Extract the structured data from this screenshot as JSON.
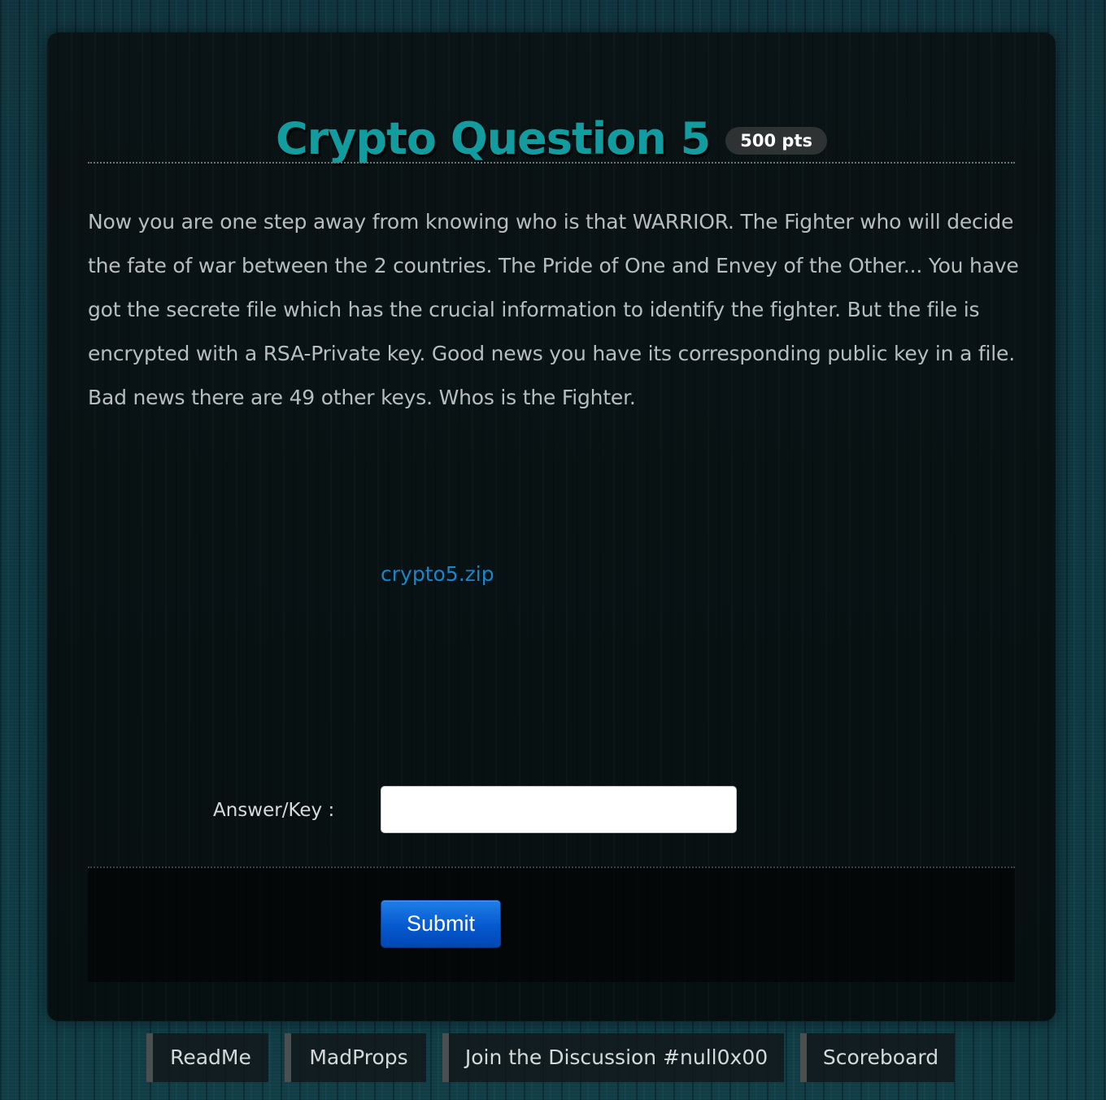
{
  "challenge": {
    "title": "Crypto Question 5",
    "points": "500 pts",
    "description": "Now you are one step away from knowing who is that WARRIOR. The Fighter who will decide the fate of war between the 2 countries. The Pride of One and Envey of the Other... You have got the secrete file which has the crucial information to identify the fighter. But the file is encrypted with a RSA-Private key. Good news you have its corresponding public key in a file. Bad news there are 49 other keys. Whos is the Fighter.",
    "attachment": "crypto5.zip"
  },
  "form": {
    "answer_label": "Answer/Key :",
    "answer_value": "",
    "answer_placeholder": "",
    "submit_label": "Submit"
  },
  "footer_nav": [
    {
      "label": "ReadMe"
    },
    {
      "label": "MadProps"
    },
    {
      "label": "Join the Discussion #null0x00"
    },
    {
      "label": "Scoreboard"
    }
  ],
  "colors": {
    "title": "#139c9f",
    "link": "#1a85c9",
    "button": "#0659cf",
    "background": "#123a42",
    "card": "#071011"
  }
}
